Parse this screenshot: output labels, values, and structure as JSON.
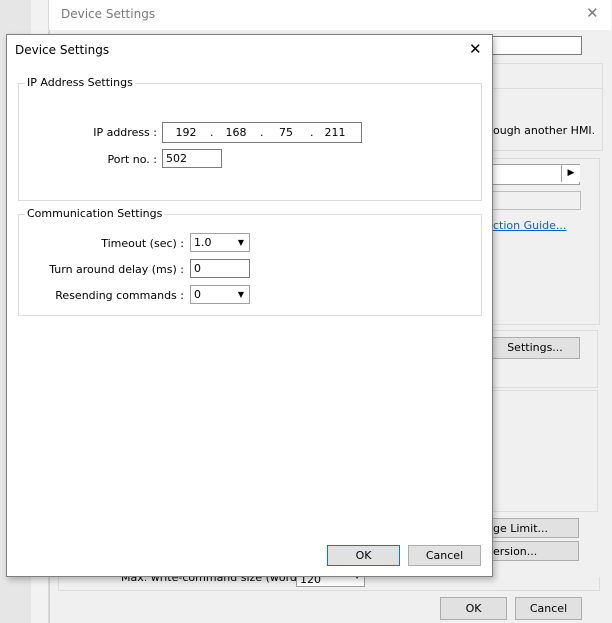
{
  "background_window": {
    "title": "Device Settings",
    "close_icon": "close-icon",
    "through_text": "ough another HMI.",
    "link_text": "ction Guide...",
    "settings_button": "Settings...",
    "age_limit_button": "ge Limit...",
    "version_button": "ersion...",
    "max_write_label": "Max. write-command size (words) :",
    "max_write_value": "120",
    "ok_button": "OK",
    "cancel_button": "Cancel"
  },
  "dialog": {
    "title": "Device Settings",
    "close_icon": "close-icon",
    "ip_group": {
      "legend": "IP Address Settings",
      "ip_label": "IP address :",
      "ip_octets": [
        "192",
        "168",
        "75",
        "211"
      ],
      "port_label": "Port no. :",
      "port_value": "502"
    },
    "comm_group": {
      "legend": "Communication Settings",
      "timeout_label": "Timeout (sec) :",
      "timeout_value": "1.0",
      "turnaround_label": "Turn around delay (ms) :",
      "turnaround_value": "0",
      "resend_label": "Resending commands :",
      "resend_value": "0"
    },
    "ok_button": "OK",
    "cancel_button": "Cancel"
  }
}
